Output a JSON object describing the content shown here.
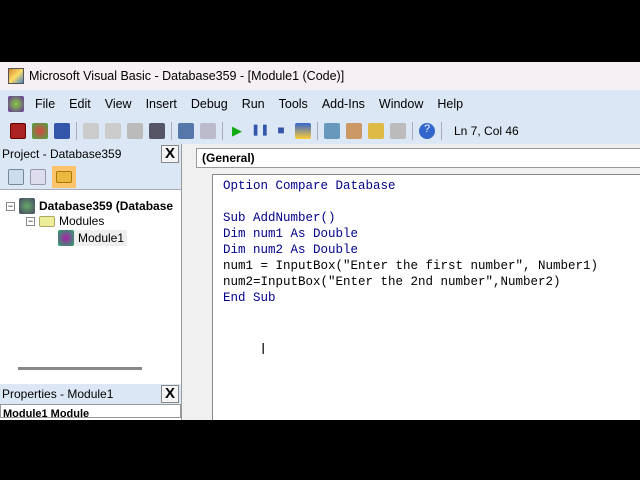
{
  "window": {
    "title": "Microsoft Visual Basic - Database359 - [Module1 (Code)]"
  },
  "menu": [
    "File",
    "Edit",
    "View",
    "Insert",
    "Debug",
    "Run",
    "Tools",
    "Add-Ins",
    "Window",
    "Help"
  ],
  "toolbar": {
    "status": "Ln 7, Col 46"
  },
  "project": {
    "title": "Project - Database359",
    "root": "Database359 (Database",
    "folder": "Modules",
    "module": "Module1"
  },
  "properties": {
    "title": "Properties - Module1",
    "object": "Module1 Module"
  },
  "code": {
    "procedure": "(General)",
    "lines": [
      "Option Compare Database",
      "",
      "Sub AddNumber()",
      "Dim num1 As Double",
      "Dim num2 As Double",
      "num1 = InputBox(\"Enter the first number\", Number1)",
      "num2=InputBox(\"Enter the 2nd number\",Number2)",
      "End Sub"
    ]
  },
  "close_label": "X"
}
